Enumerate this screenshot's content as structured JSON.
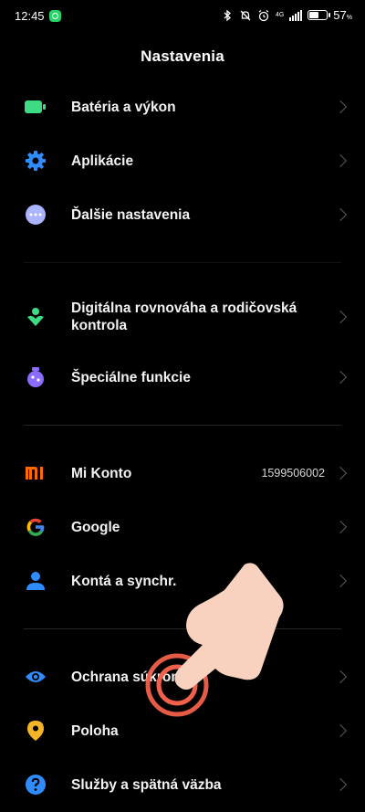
{
  "status_bar": {
    "time": "12:45",
    "network": "4G",
    "battery_percent": "57",
    "battery_level": 0.57
  },
  "header": {
    "title": "Nastavenia"
  },
  "sections": [
    {
      "items": [
        {
          "label": "Batéria a výkon",
          "icon": "battery-icon"
        },
        {
          "label": "Aplikácie",
          "icon": "gear-icon"
        },
        {
          "label": "Ďalšie nastavenia",
          "icon": "more-dots-icon"
        }
      ]
    },
    {
      "items": [
        {
          "label": "Digitálna rovnováha a rodičovská kontrola",
          "icon": "digital-wellbeing-icon"
        },
        {
          "label": "Špeciálne funkcie",
          "icon": "special-features-icon"
        }
      ]
    },
    {
      "items": [
        {
          "label": "Mi Konto",
          "value": "1599506002",
          "icon": "mi-logo-icon"
        },
        {
          "label": "Google",
          "icon": "google-icon"
        },
        {
          "label": "Kontá a synchr.",
          "icon": "account-person-icon"
        }
      ]
    },
    {
      "items": [
        {
          "label": "Ochrana súkromia",
          "icon": "eye-icon"
        },
        {
          "label": "Poloha",
          "icon": "location-pin-icon"
        },
        {
          "label": "Služby a spätná väzba",
          "icon": "help-question-icon"
        }
      ]
    }
  ],
  "colors": {
    "battery_green": "#3ddc84",
    "settings_blue": "#2f8cff",
    "more_lavender": "#aab4ff",
    "wellbeing_green": "#3ddc84",
    "special_purple": "#8a6cff",
    "mi_orange": "#ff6900",
    "account_blue": "#2f8cff",
    "privacy_blue": "#2f8cff",
    "location_yellow": "#f5b528",
    "help_blue": "#2f8cff",
    "hand_skin": "#f8d2bf",
    "tap_ring_red": "#f0604a"
  }
}
